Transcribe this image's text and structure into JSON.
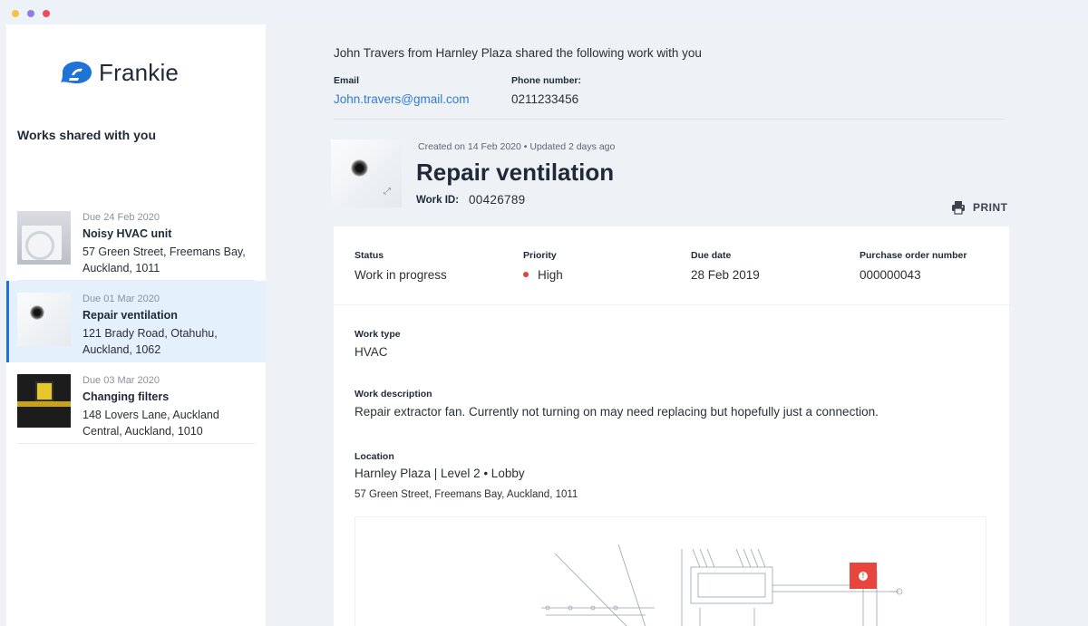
{
  "app": {
    "name": "Frankie"
  },
  "sidebar": {
    "heading": "Works shared with you",
    "items": [
      {
        "due": "Due 24 Feb 2020",
        "title": "Noisy HVAC unit",
        "address": "57 Green Street, Freemans Bay, Auckland, 1011",
        "selected": false
      },
      {
        "due": "Due 01 Mar 2020",
        "title": "Repair ventilation",
        "address": "121  Brady Road, Otahuhu, Auckland, 1062",
        "selected": true
      },
      {
        "due": "Due 03 Mar 2020",
        "title": "Changing filters",
        "address": "148  Lovers Lane, Auckland Central, Auckland, 1010",
        "selected": false
      }
    ]
  },
  "header": {
    "shared_line": "John Travers from Harnley Plaza shared the following work with you",
    "email_label": "Email",
    "email_value": "John.travers@gmail.com",
    "phone_label": "Phone number:",
    "phone_value": "0211233456"
  },
  "work": {
    "meta": "Created on 14 Feb 2020 • Updated 2 days ago",
    "title": "Repair ventilation",
    "id_label": "Work ID:",
    "id_value": "00426789",
    "print_label": "PRINT"
  },
  "status_card": {
    "status_label": "Status",
    "status_value": "Work in progress",
    "priority_label": "Priority",
    "priority_value": "High",
    "due_label": "Due date",
    "due_value": "28 Feb 2019",
    "po_label": "Purchase order number",
    "po_value": "000000043"
  },
  "details": {
    "work_type_label": "Work type",
    "work_type_value": "HVAC",
    "description_label": "Work description",
    "description_value": "Repair extractor fan. Currently not turning on may need replacing but hopefully just a connection.",
    "location_label": "Location",
    "location_value": "Harnley Plaza | Level 2 • Lobby",
    "location_address": "57 Green Street, Freemans Bay, Auckland, 1011"
  },
  "colors": {
    "accent": "#1f72d6",
    "link": "#2f7bd2",
    "priority_high": "#e0433e",
    "marker": "#e8453c",
    "selected_bg": "#e4f0fb"
  }
}
